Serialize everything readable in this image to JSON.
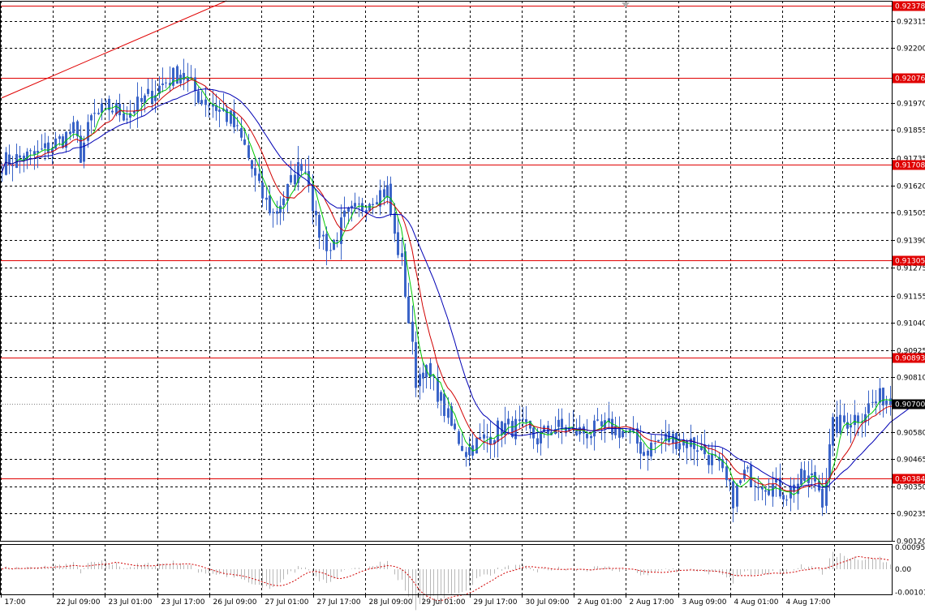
{
  "colors": {
    "background": "#ffffff",
    "grid": "#000000",
    "border": "#000000",
    "candle": "#3a64c8",
    "ma_fast": "#00c800",
    "ma_mid": "#d00000",
    "ma_slow": "#0000b4",
    "level_line": "#e00000",
    "level_label_bg": "#e00000",
    "level_label_text": "#ffffff",
    "current_label_bg": "#000000",
    "current_label_text": "#ffffff",
    "histogram": "#b8b8b8",
    "signal": "#d00000",
    "axis_text": "#000000"
  },
  "chart_data": [
    {
      "type": "candlestick",
      "title": "",
      "xlabel": "",
      "ylabel": "",
      "ylim": [
        0.9012,
        0.924
      ],
      "grid": true,
      "y_ticks": [
        "0.92315",
        "0.92200",
        "0.91970",
        "0.91855",
        "0.91735",
        "0.91620",
        "0.91505",
        "0.91390",
        "0.91275",
        "0.91155",
        "0.91040",
        "0.90925",
        "0.90810",
        "0.90580",
        "0.90465",
        "0.90350",
        "0.90235",
        "0.90120"
      ],
      "x_tick_labels": [
        "17:00",
        "22 Jul 09:00",
        "23 Jul 01:00",
        "23 Jul 17:00",
        "26 Jul 09:00",
        "27 Jul 01:00",
        "27 Jul 17:00",
        "28 Jul 09:00",
        "29 Jul 01:00",
        "29 Jul 17:00",
        "30 Jul 09:00",
        "2 Aug 01:00",
        "2 Aug 17:00",
        "3 Aug 09:00",
        "4 Aug 01:00",
        "4 Aug 17:00"
      ],
      "horizontal_levels": [
        "0.92378",
        "0.92076",
        "0.91708",
        "0.91305",
        "0.90893",
        "0.90384"
      ],
      "current_price": "0.90700",
      "trendline": {
        "from": [
          0,
          0.9199
        ],
        "to": [
          63,
          0.924
        ]
      },
      "price_path": [
        [
          0,
          0.9172
        ],
        [
          10,
          0.9175
        ],
        [
          15,
          0.918
        ],
        [
          20,
          0.9185
        ],
        [
          22,
          0.9175
        ],
        [
          25,
          0.919
        ],
        [
          30,
          0.9195
        ],
        [
          35,
          0.9192
        ],
        [
          40,
          0.9198
        ],
        [
          45,
          0.9205
        ],
        [
          50,
          0.921
        ],
        [
          55,
          0.92
        ],
        [
          60,
          0.9195
        ],
        [
          64,
          0.919
        ],
        [
          68,
          0.9178
        ],
        [
          72,
          0.916
        ],
        [
          76,
          0.915
        ],
        [
          80,
          0.916
        ],
        [
          84,
          0.9172
        ],
        [
          86,
          0.9165
        ],
        [
          88,
          0.9145
        ],
        [
          92,
          0.9135
        ],
        [
          96,
          0.9148
        ],
        [
          100,
          0.9152
        ],
        [
          104,
          0.9158
        ],
        [
          108,
          0.916
        ],
        [
          110,
          0.914
        ],
        [
          112,
          0.913
        ],
        [
          116,
          0.908
        ],
        [
          118,
          0.9085
        ],
        [
          122,
          0.9075
        ],
        [
          126,
          0.906
        ],
        [
          130,
          0.905
        ],
        [
          135,
          0.9055
        ],
        [
          140,
          0.906
        ],
        [
          145,
          0.906
        ],
        [
          150,
          0.9055
        ],
        [
          155,
          0.906
        ],
        [
          160,
          0.9058
        ],
        [
          165,
          0.9058
        ],
        [
          170,
          0.906
        ],
        [
          175,
          0.9058
        ],
        [
          180,
          0.905
        ],
        [
          185,
          0.9055
        ],
        [
          190,
          0.9055
        ],
        [
          195,
          0.9052
        ],
        [
          200,
          0.9045
        ],
        [
          205,
          0.903
        ],
        [
          208,
          0.904
        ],
        [
          212,
          0.9038
        ],
        [
          216,
          0.9035
        ],
        [
          220,
          0.9032
        ],
        [
          224,
          0.9038
        ],
        [
          228,
          0.9038
        ],
        [
          230,
          0.903
        ],
        [
          233,
          0.906
        ],
        [
          236,
          0.9062
        ],
        [
          240,
          0.9065
        ],
        [
          244,
          0.907
        ],
        [
          247,
          0.9073
        ],
        [
          250,
          0.907
        ]
      ],
      "series": [
        {
          "values": []
        },
        {
          "values": []
        },
        {
          "values": []
        }
      ],
      "moving_average_periods": [
        5,
        10,
        20
      ]
    },
    {
      "type": "bar",
      "title": "",
      "ylim": [
        -0.0011,
        0.0011
      ],
      "y_ticks": [
        "0.000956",
        "0.00",
        "-0.001011"
      ]
    }
  ]
}
